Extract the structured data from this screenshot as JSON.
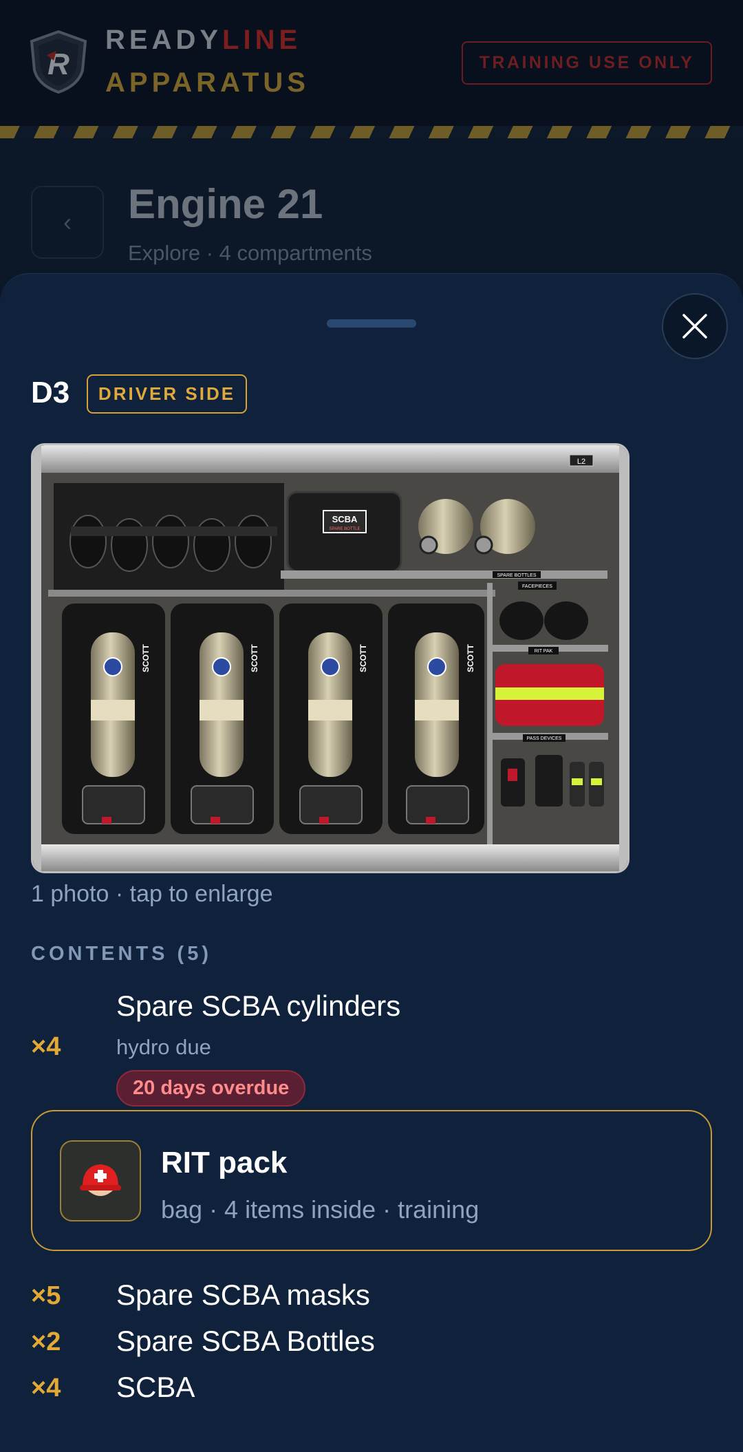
{
  "header": {
    "brand_part1": "READY",
    "brand_part2": "LINE",
    "brand_line2": "APPARATUS",
    "training_badge": "TRAINING USE ONLY",
    "logo_letter": "R"
  },
  "page": {
    "back_glyph": "‹",
    "title": "Engine 21",
    "subtitle": "Explore · 4 compartments"
  },
  "sheet": {
    "compartment_code": "D3",
    "side_label": "DRIVER SIDE",
    "photo_caption": "1 photo · tap to enlarge",
    "photo_labels": {
      "corner_tag": "L2",
      "scba_bag": "SCBA",
      "scba_bag_sub": "SPARE BOTTLE",
      "spare_bottles": "SPARE BOTTLES",
      "facepieces": "FACEPIECES",
      "rit_pak": "RIT PAK",
      "pass_devices": "PASS DEVICES",
      "cylinder_brand": "SCOTT"
    },
    "contents_heading": "CONTENTS (5)",
    "items": [
      {
        "qty": "×4",
        "name": "Spare SCBA cylinders",
        "note": "hydro due",
        "status": "20 days overdue"
      },
      {
        "name": "RIT pack",
        "details": "bag · 4 items inside · training",
        "icon": "helmet-icon"
      },
      {
        "qty": "×5",
        "name": "Spare SCBA masks"
      },
      {
        "qty": "×2",
        "name": "Spare SCBA Bottles"
      },
      {
        "qty": "×4",
        "name": "SCBA"
      }
    ]
  },
  "colors": {
    "accent_gold": "#e3a935",
    "sheet_bg": "#10223b",
    "overdue_text": "#ff8b8b",
    "brand_red": "#7c1e1e"
  }
}
